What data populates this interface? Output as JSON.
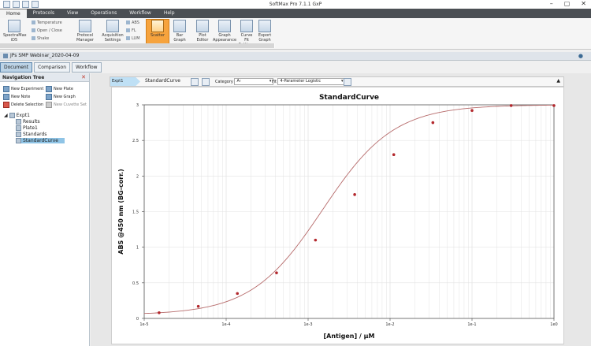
{
  "app": {
    "title": "SoftMax Pro 7.1.1 GxP",
    "window_controls": [
      "–",
      "▢",
      "✕"
    ]
  },
  "menu": [
    "Home",
    "Protocols",
    "View",
    "Operations",
    "Workflow",
    "Help"
  ],
  "ribbon": {
    "spectramax": "SpectraMax iD5",
    "temperature": "Temperature",
    "open_close": "Open / Close",
    "shake": "Shake",
    "protocol_manager": "Protocol Manager",
    "acquisition_settings": "Acquisition Settings",
    "abs": "ABS",
    "fl": "FL",
    "lum": "LUM",
    "scatter": "Scatter",
    "bar_graph": "Bar Graph",
    "plot_editor": "Plot Editor",
    "graph_appearance": "Graph Appearance",
    "curve_fit_settings": "Curve Fit Settings",
    "export_graph": "Export Graph"
  },
  "document": {
    "name": "JPs SMP Webinar_2020-04-09",
    "tabs": [
      "Document",
      "Comparison",
      "Workflow"
    ]
  },
  "nav": {
    "title": "Navigation Tree",
    "buttons": {
      "new_experiment": "New Experiment",
      "new_plate": "New Plate",
      "new_note": "New Note",
      "new_graph": "New Graph",
      "delete_selection": "Delete Selection",
      "new_cuvette_set": "New Cuvette Set"
    },
    "tree": {
      "root": "Expt1",
      "children": [
        "Results",
        "Plate1",
        "Standards",
        "StandardCurve"
      ]
    }
  },
  "graph_toolbar": {
    "expt_tab": "Expt1",
    "graph_name": "StandardCurve",
    "category_label": "Category",
    "category_value": "A‹",
    "fit_label": "Fit",
    "fit_value": "4-Parameter Logistic"
  },
  "chart_data": {
    "type": "scatter",
    "title": "StandardCurve",
    "xlabel": "[Antigen] / µM",
    "ylabel": "ABS @450 nm (BG-corr.)",
    "x_scale": "log",
    "xlim": [
      1e-05,
      1
    ],
    "ylim": [
      0,
      3
    ],
    "x_ticks": [
      1e-05,
      0.0001,
      0.001,
      0.01,
      0.1,
      1
    ],
    "x_tick_labels": [
      "1e-5",
      "1e-4",
      "1e-3",
      "1e-2",
      "1e-1",
      "1e0"
    ],
    "y_ticks": [
      0,
      0.5,
      1,
      1.5,
      2,
      2.5,
      3
    ],
    "y_tick_labels": [
      "0",
      "0.5",
      "1",
      "1.5",
      "2",
      "2.5",
      "3"
    ],
    "grid": true,
    "points": {
      "x": [
        1.52e-05,
        4.57e-05,
        0.000137,
        0.000412,
        0.00123,
        0.0037,
        0.0111,
        0.0333,
        0.1,
        0.3,
        1
      ],
      "y": [
        0.08,
        0.17,
        0.35,
        0.64,
        1.1,
        1.74,
        2.3,
        2.75,
        2.92,
        2.99,
        2.99
      ]
    },
    "fit": {
      "model": "4-Parameter Logistic",
      "A": 0.05,
      "B": 1,
      "C": 0.0015,
      "D": 3.0
    },
    "colors": {
      "points": "#b3282d",
      "curve": "#b66a6a",
      "grid": "#e3e3e3"
    }
  }
}
